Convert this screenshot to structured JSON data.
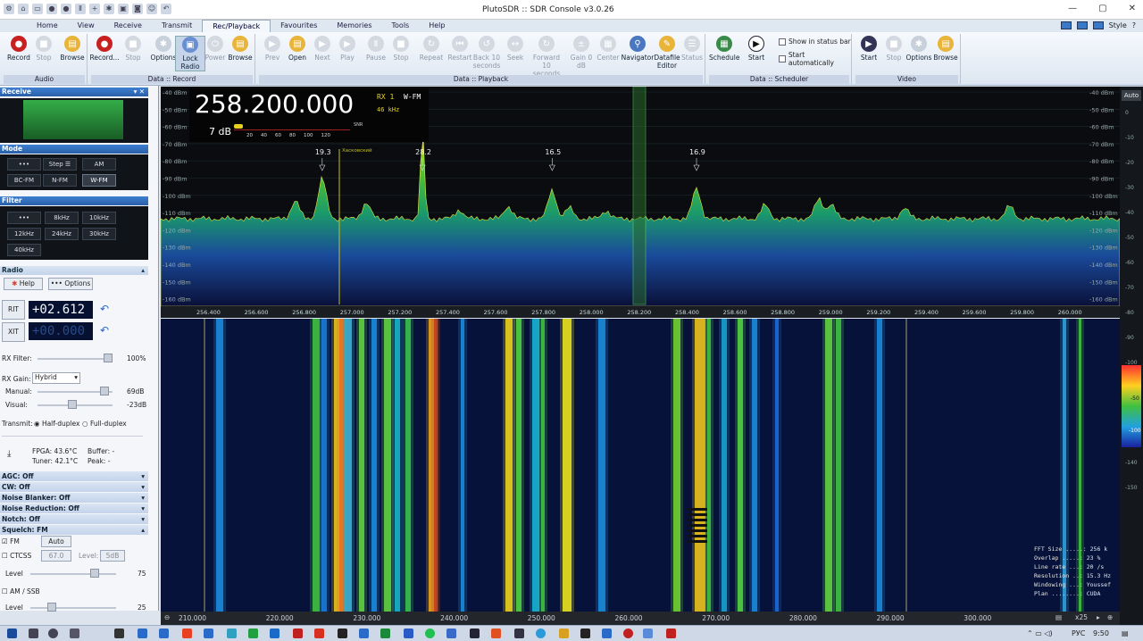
{
  "window": {
    "title": "PlutoSDR :: SDR Console v3.0.26",
    "style_label": "Style"
  },
  "tabs": [
    "Home",
    "View",
    "Receive",
    "Transmit",
    "Rec/Playback",
    "Favourites",
    "Memories",
    "Tools",
    "Help"
  ],
  "ribbon": {
    "audio": {
      "label": "Audio",
      "buttons": [
        "Record",
        "Stop",
        "Browse"
      ]
    },
    "data_record": {
      "label": "Data :: Record",
      "buttons": [
        "Record...",
        "Stop",
        "Options",
        "Lock Radio",
        "Power",
        "Browse"
      ]
    },
    "data_playback": {
      "label": "Data :: Playback",
      "buttons": [
        "Prev",
        "Open",
        "Next",
        "Play",
        "Pause",
        "Stop",
        "Repeat",
        "Restart",
        "Back 10 seconds",
        "Seek",
        "Forward 10 seconds",
        "Gain 0 dB",
        "Center",
        "Navigator",
        "Datafile Editor",
        "Status"
      ]
    },
    "scheduler": {
      "label": "Data :: Scheduler",
      "buttons": [
        "Schedule",
        "Start"
      ],
      "checks": [
        "Show in status bar",
        "Start automatically"
      ]
    },
    "video": {
      "label": "Video",
      "buttons": [
        "Start",
        "Stop",
        "Options",
        "Browse"
      ]
    }
  },
  "left": {
    "receive_title": "Receive",
    "mode_title": "Mode",
    "modes": [
      "•••",
      "Step ☰",
      "AM",
      "BC-FM",
      "N-FM",
      "W-FM"
    ],
    "filter_title": "Filter",
    "filters": [
      "•••",
      "8kHz",
      "10kHz",
      "12kHz",
      "24kHz",
      "30kHz",
      "40kHz"
    ],
    "radio_title": "Radio",
    "help": "Help",
    "options": "••• Options",
    "rit_label": "RIT",
    "rit_value": "+02.612",
    "xit_label": "XIT",
    "xit_value": "+00.000",
    "rx_filter_label": "RX Filter:",
    "rx_filter_value": "100%",
    "rx_gain_label": "RX Gain:",
    "rx_gain_value": "Hybrid",
    "manual_label": "Manual:",
    "manual_value": "69dB",
    "visual_label": "Visual:",
    "visual_value": "-23dB",
    "transmit_label": "Transmit:",
    "half_duplex": "Half-duplex",
    "full_duplex": "Full-duplex",
    "fpga": "FPGA: 43.6°C",
    "tuner": "Tuner: 42.1°C",
    "buffer": "Buffer: -",
    "peak": "Peak: -",
    "collapsed": [
      "AGC: Off",
      "CW: Off",
      "Noise Blanker: Off",
      "Noise Reduction: Off",
      "Notch: Off"
    ],
    "squelch_title": "Squelch: FM",
    "fm_label": "FM",
    "auto_label": "Auto",
    "ctcss_label": "CTCSS",
    "ctcss_value": "67.0",
    "level_label": "Level:",
    "level_value": "5dB",
    "level1_label": "Level",
    "level1_value": "75",
    "amssb_label": "AM / SSB",
    "level2_label": "Level",
    "level2_value": "25"
  },
  "spectrum": {
    "frequency": "258.200.000",
    "rx": "RX 1",
    "mode": "W-FM",
    "bw": "46 kHz",
    "db": "7 dB",
    "snr_label": "SNR",
    "snr_ticks": [
      "20",
      "40",
      "60",
      "80",
      "100",
      "120"
    ],
    "station_label": "Хасковский",
    "dbm_labels": [
      "-40 dBm",
      "-50 dBm",
      "-60 dBm",
      "-70 dBm",
      "-80 dBm",
      "-90 dBm",
      "-100 dBm",
      "-110 dBm",
      "-120 dBm",
      "-130 dBm",
      "-140 dBm",
      "-150 dBm",
      "-160 dBm"
    ],
    "peaks": [
      {
        "freq": 256.94,
        "label": "19.3"
      },
      {
        "freq": 257.35,
        "label": "28.2"
      },
      {
        "freq": 257.88,
        "label": "16.5"
      },
      {
        "freq": 258.47,
        "label": "16.9"
      }
    ],
    "freq_ticks": [
      "256.400",
      "256.600",
      "256.800",
      "257.000",
      "257.200",
      "257.400",
      "257.600",
      "257.800",
      "258.000",
      "258.200",
      "258.400",
      "258.600",
      "258.800",
      "259.000",
      "259.200",
      "259.400",
      "259.600",
      "259.800",
      "260.000"
    ],
    "auto_label": "Auto",
    "right_scale": [
      "0",
      "-10",
      "-20",
      "-30",
      "-40",
      "-50",
      "-60",
      "-70",
      "-80",
      "-90",
      "-100",
      "-110",
      "-120",
      "-130",
      "-140",
      "-150"
    ]
  },
  "waterfall": {
    "ticks": [
      "210.000",
      "220.000",
      "230.000",
      "240.000",
      "250.000",
      "260.000",
      "270.000",
      "280.000",
      "290.000",
      "300.000"
    ],
    "zoom": "x25",
    "fft_info": [
      "FFT Size .....: 256 k",
      "Overlap .....: 23 %",
      "Line rate ...: 20 /s",
      "Resolution ..: 15.3 Hz",
      "Windowing ...: Youssef",
      "Plan ........: CUDA"
    ],
    "colorbar": [
      "-50",
      "-100"
    ]
  },
  "taskbar": {
    "lang": "РУС",
    "time": "9:50"
  }
}
